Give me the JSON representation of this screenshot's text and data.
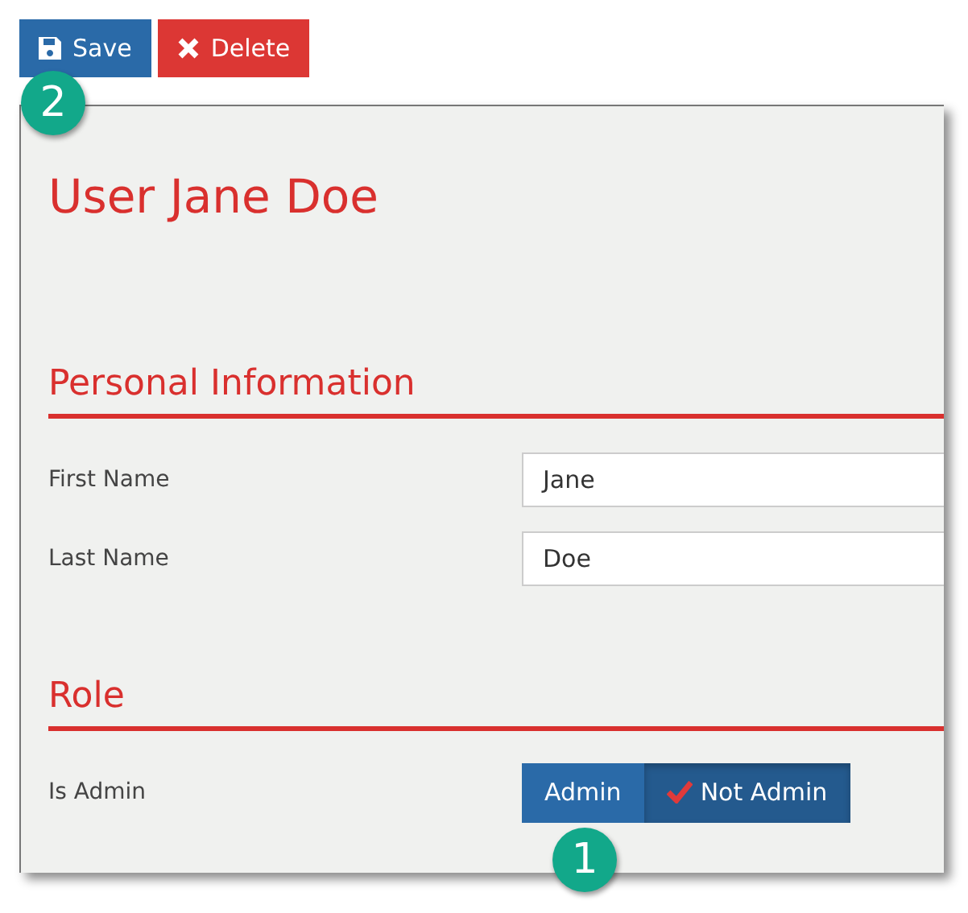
{
  "toolbar": {
    "buttons": [
      {
        "label": "Save",
        "kind": "save"
      },
      {
        "label": "Delete",
        "kind": "delete"
      }
    ]
  },
  "title": "User Jane Doe",
  "sections": [
    {
      "heading": "Personal Information",
      "fields": [
        {
          "label": "First Name",
          "kind": "text",
          "value": "Jane"
        },
        {
          "label": "Last Name",
          "kind": "text",
          "value": "Doe"
        }
      ]
    },
    {
      "heading": "Role",
      "fields": [
        {
          "label": "Is Admin",
          "kind": "toggle",
          "options": [
            {
              "label": "Admin",
              "selected": false
            },
            {
              "label": "Not Admin",
              "selected": true
            }
          ]
        }
      ]
    }
  ],
  "callouts": [
    {
      "number": "2"
    },
    {
      "number": "1"
    }
  ]
}
